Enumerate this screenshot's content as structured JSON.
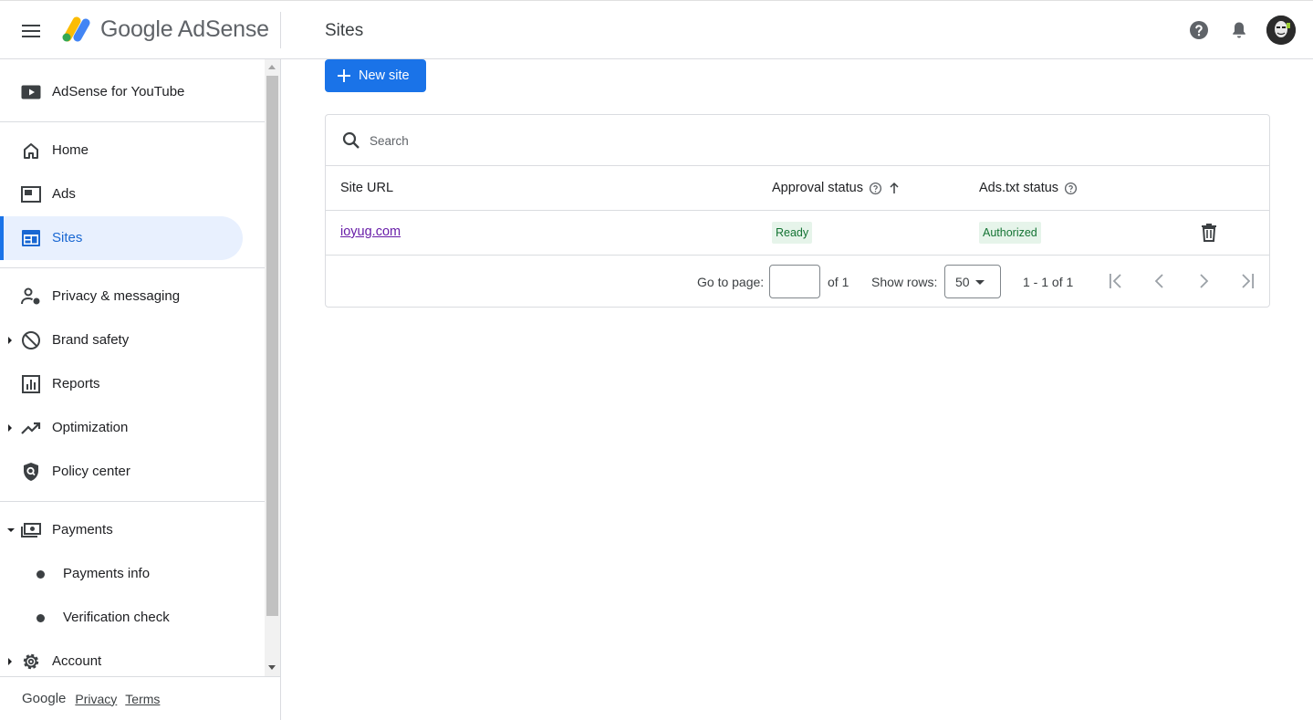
{
  "app": {
    "brand_google": "Google",
    "brand_product": "AdSense"
  },
  "header": {
    "page_title": "Sites"
  },
  "sidebar": {
    "items": [
      {
        "label": "AdSense for YouTube",
        "icon": "youtube-icon"
      },
      {
        "label": "Home",
        "icon": "home-icon"
      },
      {
        "label": "Ads",
        "icon": "ads-icon"
      },
      {
        "label": "Sites",
        "icon": "sites-icon",
        "active": true
      },
      {
        "label": "Privacy & messaging",
        "icon": "privacy-icon"
      },
      {
        "label": "Brand safety",
        "icon": "block-icon",
        "expandable": true
      },
      {
        "label": "Reports",
        "icon": "reports-icon"
      },
      {
        "label": "Optimization",
        "icon": "trending-up-icon",
        "expandable": true
      },
      {
        "label": "Policy center",
        "icon": "policy-shield-icon"
      },
      {
        "label": "Payments",
        "icon": "payments-icon",
        "expanded": true
      },
      {
        "label": "Payments info",
        "icon": "bullet-icon"
      },
      {
        "label": "Verification check",
        "icon": "bullet-icon"
      },
      {
        "label": "Account",
        "icon": "gear-icon",
        "expandable": true
      }
    ]
  },
  "footer": {
    "brand": "Google",
    "privacy": "Privacy",
    "terms": "Terms"
  },
  "main": {
    "new_site_label": "New site",
    "search_placeholder": "Search",
    "columns": {
      "site_url": "Site URL",
      "approval_status": "Approval status",
      "ads_txt_status": "Ads.txt status"
    },
    "rows": [
      {
        "site_url": "ioyug.com",
        "approval_status": "Ready",
        "ads_txt_status": "Authorized"
      }
    ],
    "pager": {
      "go_to_page": "Go to page:",
      "of_pages": "of 1",
      "show_rows": "Show rows:",
      "rows_value": "50",
      "range": "1 - 1 of 1"
    }
  },
  "colors": {
    "accent": "#1a73e8",
    "active_bg": "#e8f0fe",
    "ready_bg": "#e6f4ea",
    "ready_text": "#137333",
    "visited_link": "#681da8"
  }
}
